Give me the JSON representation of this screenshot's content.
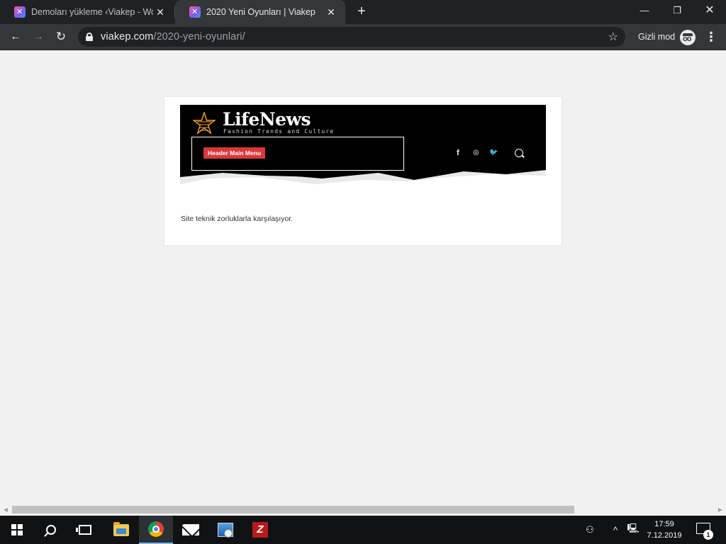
{
  "browser": {
    "tabs": [
      {
        "title": "Demoları yükleme ‹Viakep - WordPress",
        "active": false
      },
      {
        "title": "2020 Yeni Oyunları | Viakep",
        "active": true
      }
    ],
    "address": {
      "domain": "viakep.com",
      "path": "/2020-yeni-oyunlari/"
    },
    "incognito_label": "Gizli mod"
  },
  "page": {
    "logo_title": "LifeNews",
    "logo_subtitle": "Fashion Trends and Culture",
    "menu_button": "Header Main Menu",
    "social": [
      "f",
      "◎",
      "🐦"
    ],
    "message": "Site teknik zorluklarla karşılaşıyor."
  },
  "taskbar": {
    "time": "17:59",
    "date": "7.12.2019",
    "notification_count": "1"
  },
  "colors": {
    "tab_bar": "#202124",
    "toolbar": "#35363a",
    "page_bg": "#f1f1f1",
    "header_bg": "#000000",
    "menu_pill": "#d9393b",
    "logo_star": "#f0a030",
    "taskbar": "#101214"
  }
}
